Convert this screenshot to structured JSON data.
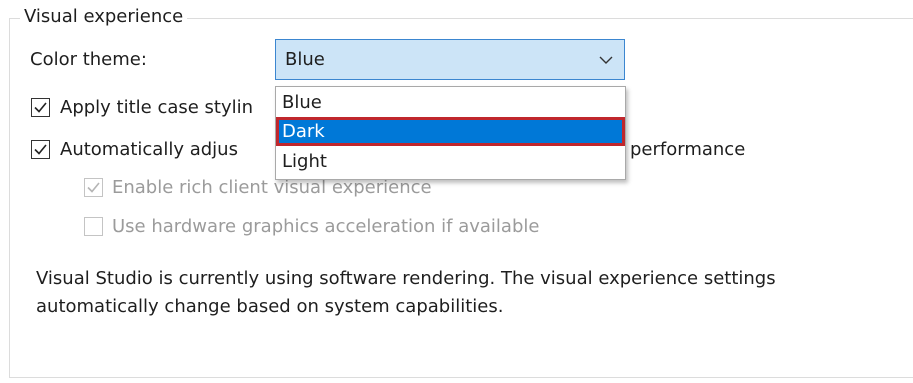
{
  "group": {
    "title": "Visual experience"
  },
  "color_theme": {
    "label": "Color theme:",
    "selected": "Blue",
    "options": [
      "Blue",
      "Dark",
      "Light"
    ],
    "highlighted": "Dark"
  },
  "options": {
    "title_case": {
      "label_visible": "Apply title case stylin",
      "checked": true
    },
    "auto_adjust": {
      "label_left": "Automatically adjus",
      "label_right": "performance",
      "checked": true
    },
    "rich_client": {
      "label": "Enable rich client visual experience",
      "checked": true,
      "enabled": false
    },
    "hw_accel": {
      "label": "Use hardware graphics acceleration if available",
      "checked": false,
      "enabled": false
    }
  },
  "description": "Visual Studio is currently using software rendering.  The visual experience settings automatically change based on system capabilities.",
  "icons": {
    "combo_arrow": "chevron-down-icon",
    "check": "checkmark-icon"
  },
  "colors": {
    "combo_background": "#cce4f7",
    "combo_border": "#3b86d0",
    "selection": "#0078d7",
    "highlight_outline": "#c0272d"
  }
}
